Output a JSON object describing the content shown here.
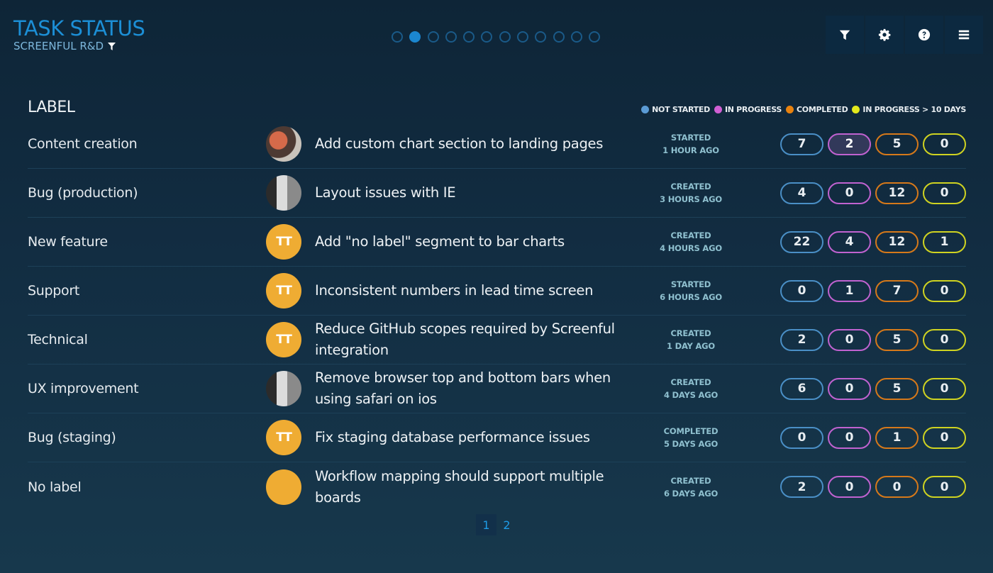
{
  "header": {
    "title": "TASK STATUS",
    "subtitle": "SCREENFUL R&D",
    "subtitle_icon": "filter-icon"
  },
  "carousel": {
    "count": 12,
    "active_index": 1
  },
  "toolbar": [
    {
      "name": "filter-button",
      "icon": "filter-icon",
      "label": "Filter"
    },
    {
      "name": "settings-button",
      "icon": "gear-icon",
      "label": "Settings"
    },
    {
      "name": "help-button",
      "icon": "help-icon",
      "label": "Help"
    },
    {
      "name": "menu-button",
      "icon": "menu-icon",
      "label": "Menu"
    }
  ],
  "table": {
    "label_header": "LABEL",
    "legend": [
      {
        "label": "NOT STARTED",
        "color": "#5b9bd5"
      },
      {
        "label": "IN PROGRESS",
        "color": "#d15fd3"
      },
      {
        "label": "COMPLETED",
        "color": "#e8820f"
      },
      {
        "label": "IN PROGRESS > 10 DAYS",
        "color": "#e3e81c"
      }
    ],
    "rows": [
      {
        "label": "Content creation",
        "avatar": "photo-a",
        "initials": "",
        "task": "Add custom chart section to landing pages",
        "status": "STARTED",
        "time": "1 HOUR AGO",
        "counts": [
          7,
          2,
          5,
          0
        ],
        "highlight": 1
      },
      {
        "label": "Bug (production)",
        "avatar": "photo-b",
        "initials": "",
        "task": "Layout issues with IE",
        "status": "CREATED",
        "time": "3 HOURS AGO",
        "counts": [
          4,
          0,
          12,
          0
        ],
        "highlight": -1
      },
      {
        "label": "New feature",
        "avatar": "initials",
        "initials": "TT",
        "task": "Add \"no label\" segment to bar charts",
        "status": "CREATED",
        "time": "4 HOURS AGO",
        "counts": [
          22,
          4,
          12,
          1
        ],
        "highlight": -1
      },
      {
        "label": "Support",
        "avatar": "initials",
        "initials": "TT",
        "task": "Inconsistent numbers in lead time screen",
        "status": "STARTED",
        "time": "6 HOURS AGO",
        "counts": [
          0,
          1,
          7,
          0
        ],
        "highlight": -1
      },
      {
        "label": "Technical",
        "avatar": "initials",
        "initials": "TT",
        "task": "Reduce GitHub scopes required by Screenful integration",
        "status": "CREATED",
        "time": "1 DAY AGO",
        "counts": [
          2,
          0,
          5,
          0
        ],
        "highlight": -1
      },
      {
        "label": "UX improvement",
        "avatar": "photo-b",
        "initials": "",
        "task": "Remove browser top and bottom bars when using safari on ios",
        "status": "CREATED",
        "time": "4 DAYS AGO",
        "counts": [
          6,
          0,
          5,
          0
        ],
        "highlight": -1
      },
      {
        "label": "Bug (staging)",
        "avatar": "initials",
        "initials": "TT",
        "task": "Fix staging database performance issues",
        "status": "COMPLETED",
        "time": "5 DAYS AGO",
        "counts": [
          0,
          0,
          1,
          0
        ],
        "highlight": -1
      },
      {
        "label": "No label",
        "avatar": "initials",
        "initials": "",
        "task": "Workflow mapping should support multiple boards",
        "status": "CREATED",
        "time": "6 DAYS AGO",
        "counts": [
          2,
          0,
          0,
          0
        ],
        "highlight": -1
      }
    ]
  },
  "pagination": {
    "pages": [
      "1",
      "2"
    ],
    "current": "1"
  }
}
